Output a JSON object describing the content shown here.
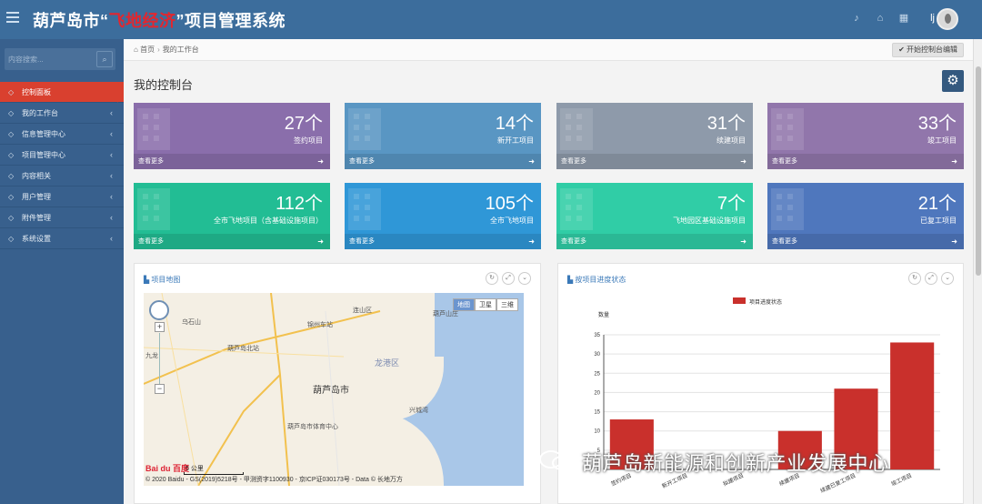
{
  "header": {
    "title_prefix": "葫芦岛市“",
    "title_highlight": "飞地经济",
    "title_suffix": "”项目管理系统",
    "user_initial": "lj"
  },
  "sidebar": {
    "search_placeholder": "内容搜索...",
    "items": [
      {
        "label": "控制面板",
        "icon": "home-icon",
        "active": true
      },
      {
        "label": "我的工作台",
        "icon": "smile-icon"
      },
      {
        "label": "信息管理中心",
        "icon": "document-icon"
      },
      {
        "label": "项目管理中心",
        "icon": "building-icon"
      },
      {
        "label": "内容相关",
        "icon": "edit-icon"
      },
      {
        "label": "用户管理",
        "icon": "user-icon"
      },
      {
        "label": "附件管理",
        "icon": "tag-icon"
      },
      {
        "label": "系统设置",
        "icon": "gear-icon"
      }
    ]
  },
  "breadcrumb": {
    "home": "首页",
    "current": "我的工作台"
  },
  "edit_button": "开始控制台编辑",
  "page_title": "我的控制台",
  "cards": [
    {
      "num": "27个",
      "label": "签约项目",
      "more": "查看更多",
      "color": "#8a6eab"
    },
    {
      "num": "14个",
      "label": "新开工项目",
      "more": "查看更多",
      "color": "#5996c3"
    },
    {
      "num": "31个",
      "label": "续建项目",
      "more": "查看更多",
      "color": "#8e9aaa"
    },
    {
      "num": "33个",
      "label": "竣工项目",
      "more": "查看更多",
      "color": "#9176ab"
    },
    {
      "num": "112个",
      "label": "全市飞地项目（含基础设施项目）",
      "more": "查看更多",
      "color": "#22bd94"
    },
    {
      "num": "105个",
      "label": "全市飞地项目",
      "more": "查看更多",
      "color": "#2f97d7"
    },
    {
      "num": "7个",
      "label": "飞地园区基础设施项目",
      "more": "查看更多",
      "color": "#30cda6"
    },
    {
      "num": "21个",
      "label": "已复工项目",
      "more": "查看更多",
      "color": "#4f77bd"
    }
  ],
  "map_panel": {
    "title": "项目地图",
    "type_map": "地图",
    "type_satellite": "卫星",
    "type_3d": "三维",
    "scale": "5 公里",
    "copyright": "© 2020 Baidu - GS(2019)5218号 - 甲测资字1100930 - 京ICP证030173号 - Data © 长地万方",
    "places": {
      "city": "葫芦岛市",
      "district": "龙港区",
      "wugui": "乌石山",
      "beizhan": "葫芦岛北站",
      "yanshan": "连山区",
      "mountain": "葫芦山庄",
      "jiulong": "九龙",
      "station2": "锦州车站",
      "xinghai": "兴城湾",
      "tiyu": "葫芦岛市体育中心"
    },
    "baidu": "Bai du 百度"
  },
  "chart_panel": {
    "title": "按项目进度状态"
  },
  "chart_data": {
    "type": "bar",
    "legend": "项目进度状态",
    "ylabel": "数量",
    "ylim": [
      0,
      35
    ],
    "yticks": [
      0,
      5,
      10,
      15,
      20,
      25,
      30,
      35
    ],
    "categories": [
      "签约项目",
      "新开工项目",
      "拟建项目",
      "续建项目",
      "续建已复工项目",
      "竣工项目"
    ],
    "values": [
      13,
      0,
      0,
      10,
      21,
      33
    ],
    "color": "#c9302c",
    "legend_position": "top"
  },
  "watermark": "葫芦岛新能源和创新产业发展中心"
}
